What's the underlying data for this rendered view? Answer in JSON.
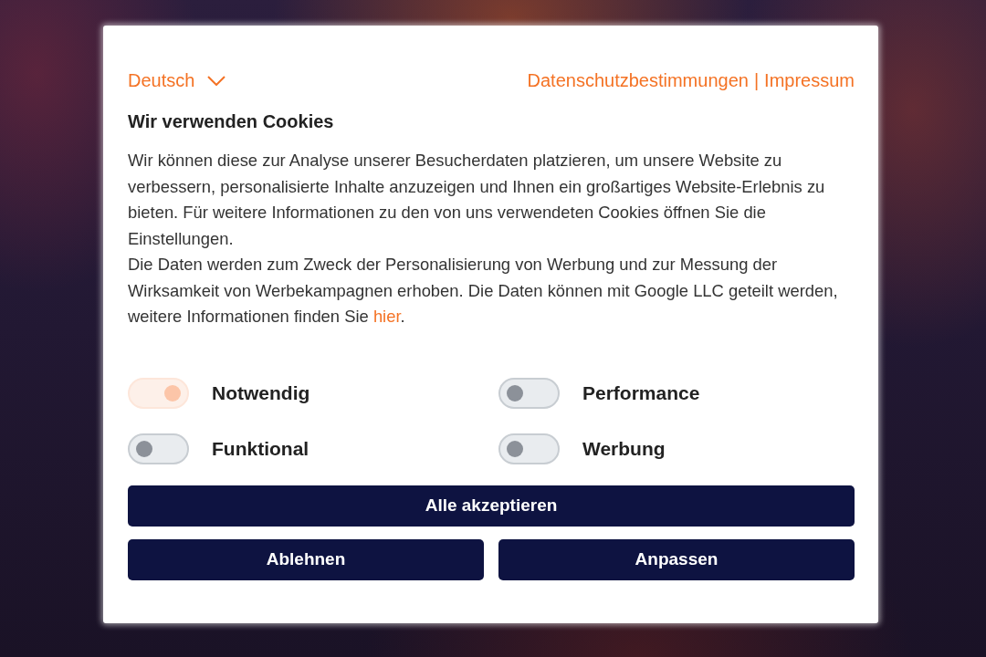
{
  "language_selector": {
    "label": "Deutsch"
  },
  "header_links": {
    "items": [
      {
        "label": "Datenschutzbestimmungen"
      },
      {
        "label": "Impressum"
      }
    ],
    "separator": "|"
  },
  "title": "Wir verwenden Cookies",
  "paragraphs": [
    {
      "text": "Wir können diese zur Analyse unserer Besucherdaten platzieren, um unsere Website zu verbessern, personalisierte Inhalte anzuzeigen und Ihnen ein großartiges Website-Erlebnis zu bieten. Für weitere Informationen zu den von uns verwendeten Cookies öffnen Sie die Einstellungen."
    },
    {
      "text": "Die Daten werden zum Zweck der Personalisierung von Werbung und zur Messung der Wirksamkeit von Werbekampagnen erhoben. Die Daten können mit Google LLC geteilt werden, weitere Informationen finden Sie ",
      "link": "hier",
      "after": "."
    }
  ],
  "toggles": [
    {
      "label": "Notwendig",
      "on": true,
      "disabled": true
    },
    {
      "label": "Performance",
      "on": false,
      "disabled": false
    },
    {
      "label": "Funktional",
      "on": false,
      "disabled": false
    },
    {
      "label": "Werbung",
      "on": false,
      "disabled": false
    }
  ],
  "buttons": {
    "primary": "Alle akzeptieren",
    "secondary": [
      "Ablehnen",
      "Anpassen"
    ]
  }
}
